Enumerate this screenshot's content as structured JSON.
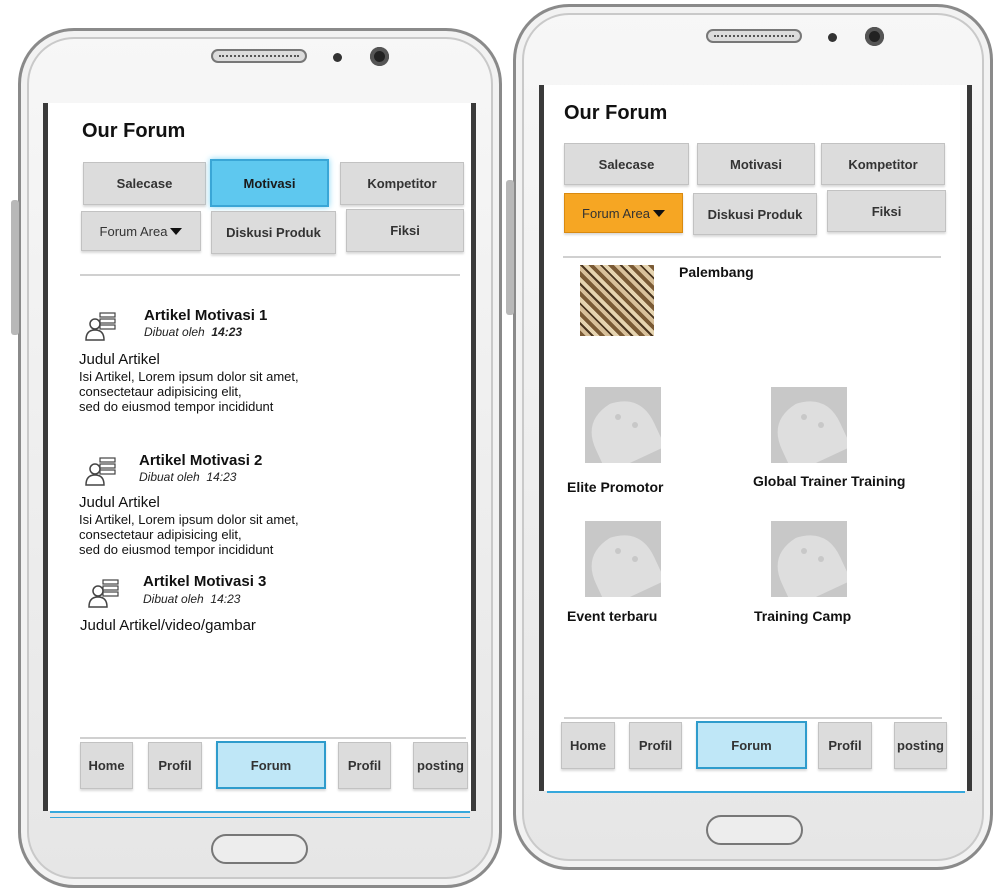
{
  "left": {
    "title": "Our Forum",
    "categories": [
      "Salecase",
      "Motivasi",
      "Kompetitor"
    ],
    "forum_area": "Forum Area",
    "categories2": [
      "Diskusi Produk",
      "Fiksi"
    ],
    "articles": [
      {
        "title": "Artikel Motivasi 1",
        "by": "Dibuat oleh",
        "time": "14:23",
        "lines": [
          "Judul Artikel",
          "Isi Artikel, Lorem ipsum dolor sit amet,",
          "consectetaur adipisicing elit,",
          "sed do eiusmod tempor incididunt"
        ]
      },
      {
        "title": "Artikel Motivasi 2",
        "by": "Dibuat oleh",
        "time": "14:23",
        "lines": [
          "Judul Artikel",
          "Isi Artikel, Lorem ipsum dolor sit amet,",
          "consectetaur adipisicing elit,",
          "sed do eiusmod tempor incididunt"
        ]
      },
      {
        "title": "Artikel Motivasi 3",
        "by": "Dibuat oleh",
        "time": "14:23",
        "lines": [
          "Judul Artikel/video/gambar"
        ]
      }
    ],
    "nav": [
      "Home",
      "Profil",
      "Forum",
      "Profil",
      "posting"
    ]
  },
  "right": {
    "title": "Our Forum",
    "categories": [
      "Salecase",
      "Motivasi",
      "Kompetitor"
    ],
    "forum_area": "Forum Area",
    "categories2": [
      "Diskusi Produk",
      "Fiksi"
    ],
    "forums": [
      "Palembang",
      "Elite Promotor",
      "Global Trainer Training",
      "Event terbaru",
      "Training Camp"
    ],
    "nav": [
      "Home",
      "Profil",
      "Forum",
      "Profil",
      "posting"
    ]
  },
  "colors": {
    "active": "#5ec8ef",
    "forum_nav": "#bfe7f7",
    "forum_area": "#f6a623",
    "accent_line": "#36a8dc"
  },
  "icons": {
    "article": "user-list-icon",
    "placeholder": "android-placeholder-icon"
  }
}
